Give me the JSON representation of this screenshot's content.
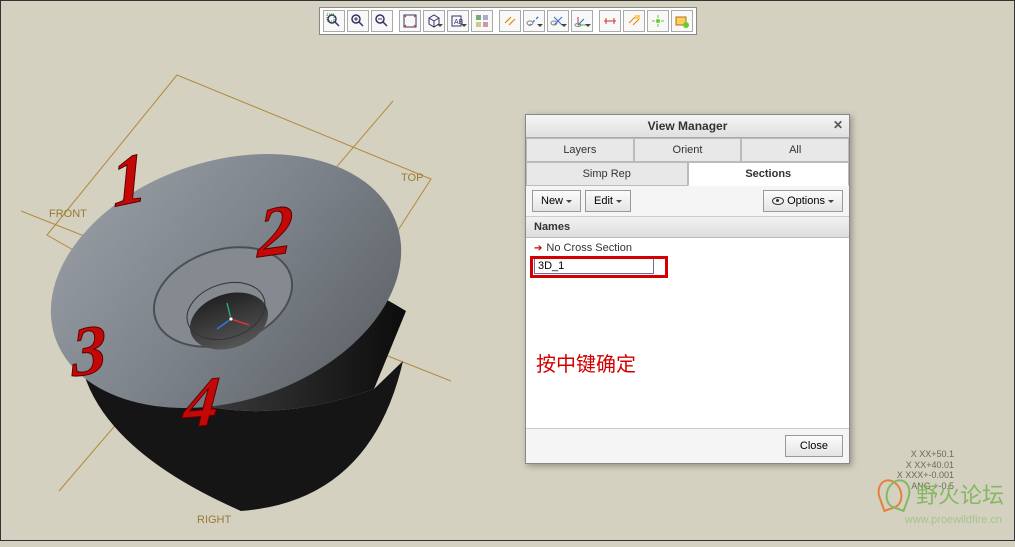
{
  "dialog": {
    "title": "View Manager",
    "tabs_row1": [
      "Layers",
      "Orient",
      "All"
    ],
    "tabs_row2": [
      "Simp Rep",
      "Sections"
    ],
    "active_tab": "Sections",
    "actions": {
      "new": "New",
      "edit": "Edit",
      "options": "Options"
    },
    "names_header": "Names",
    "no_section": "No Cross Section",
    "input_value": "3D_1",
    "annotation": "按中键确定",
    "close": "Close"
  },
  "geom": {
    "front": "FRONT",
    "top": "TOP",
    "right": "RIGHT",
    "labels": [
      "1",
      "2",
      "3",
      "4"
    ]
  },
  "status": {
    "l1": "X XX+50.1",
    "l2": "X XX+40.01",
    "l3": "X XXX+-0.001",
    "l4": "ANG +-0.5"
  },
  "watermark": {
    "text": "野火论坛",
    "url": "www.proewildfire.cn"
  }
}
